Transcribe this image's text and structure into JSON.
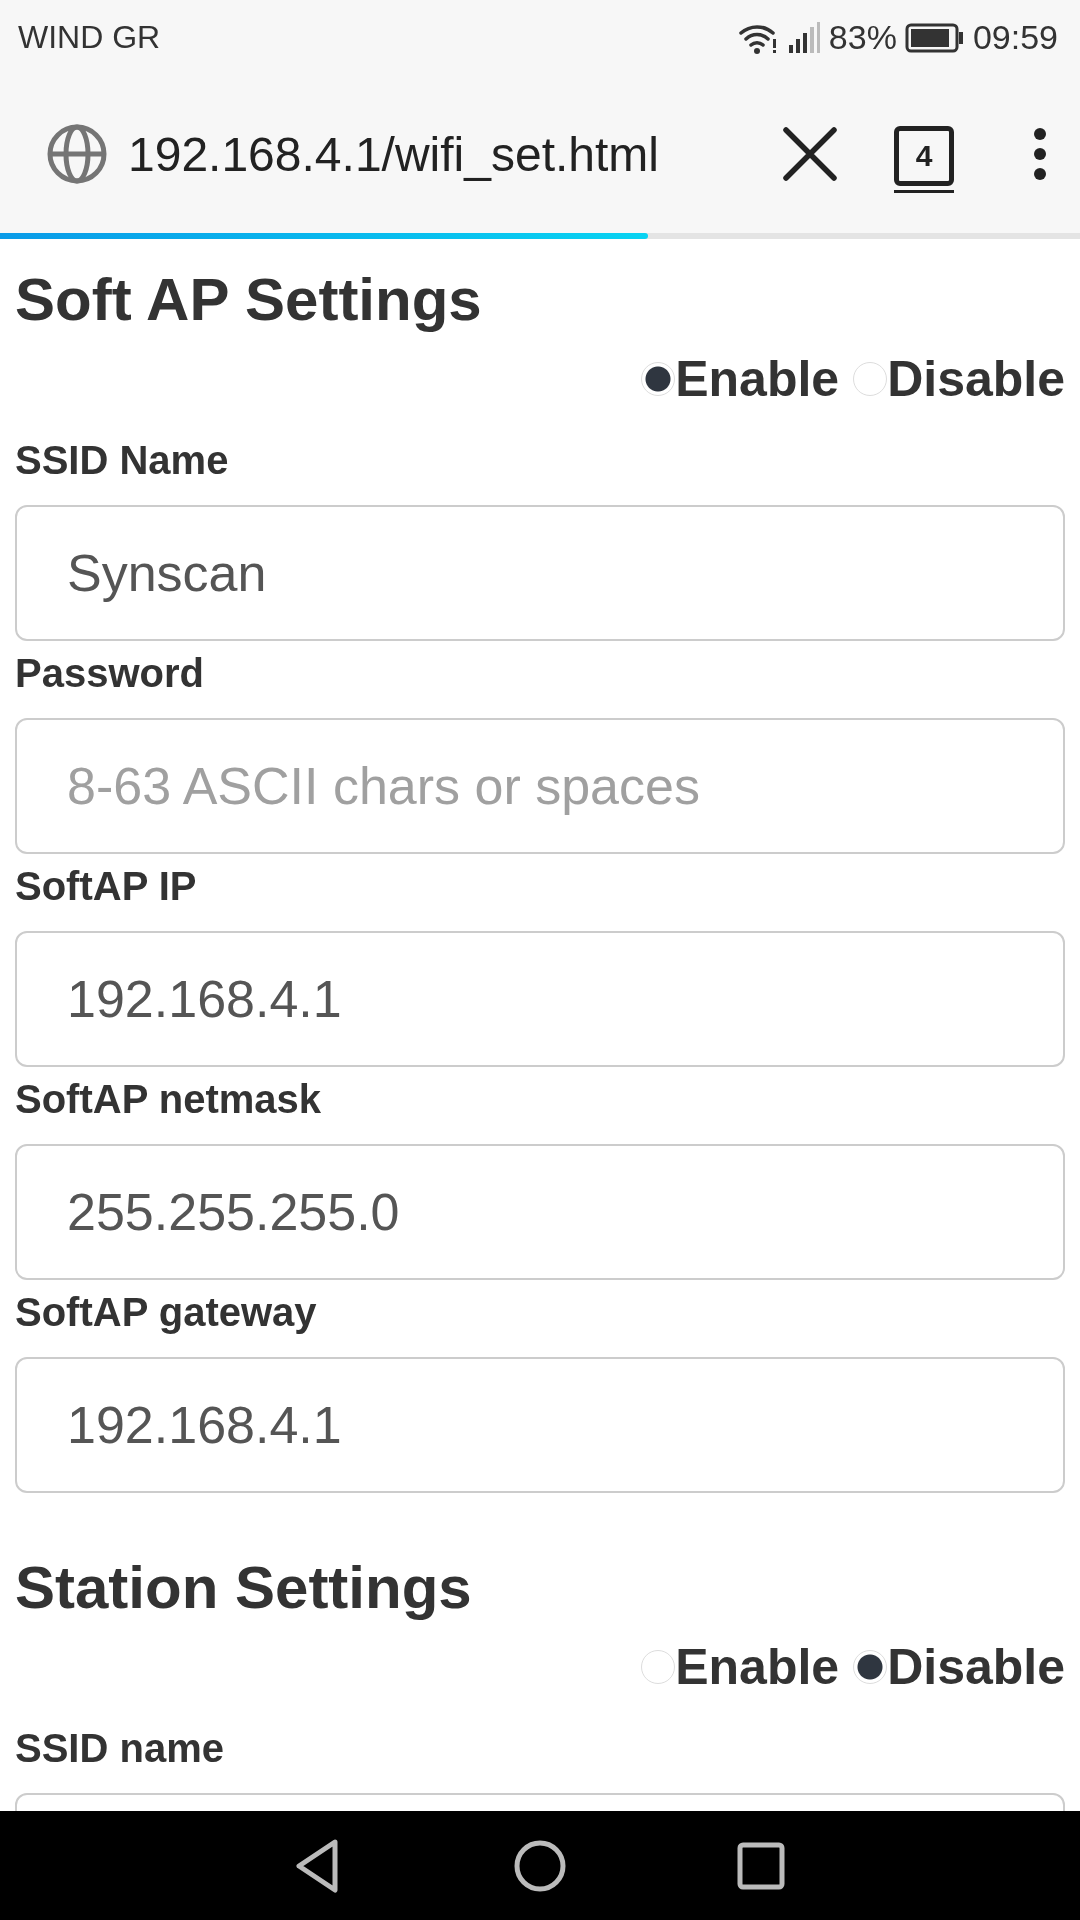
{
  "status_bar": {
    "carrier": "WIND GR",
    "battery": "83%",
    "time": "09:59"
  },
  "browser": {
    "url": "192.168.4.1/wifi_set.html",
    "tab_count": "4",
    "load": {
      "level": 0.6
    }
  },
  "sections": [
    {
      "title": "Soft AP Settings",
      "radios": [
        {
          "label": "Enable",
          "selected": true
        },
        {
          "label": "Disable",
          "selected": false
        }
      ],
      "fields": [
        {
          "label": "SSID Name",
          "value": "Synscan"
        },
        {
          "label": "Password",
          "placeholder": "8-63 ASCII chars or spaces"
        },
        {
          "label": "SoftAP IP",
          "value": "192.168.4.1"
        },
        {
          "label": "SoftAP netmask",
          "value": "255.255.255.0"
        },
        {
          "label": "SoftAP gateway",
          "value": "192.168.4.1"
        }
      ]
    },
    {
      "title": "Station Settings",
      "radios": [
        {
          "label": "Enable",
          "selected": false
        },
        {
          "label": "Disable",
          "selected": true
        }
      ],
      "fields": [
        {
          "label": "SSID name"
        }
      ]
    }
  ]
}
